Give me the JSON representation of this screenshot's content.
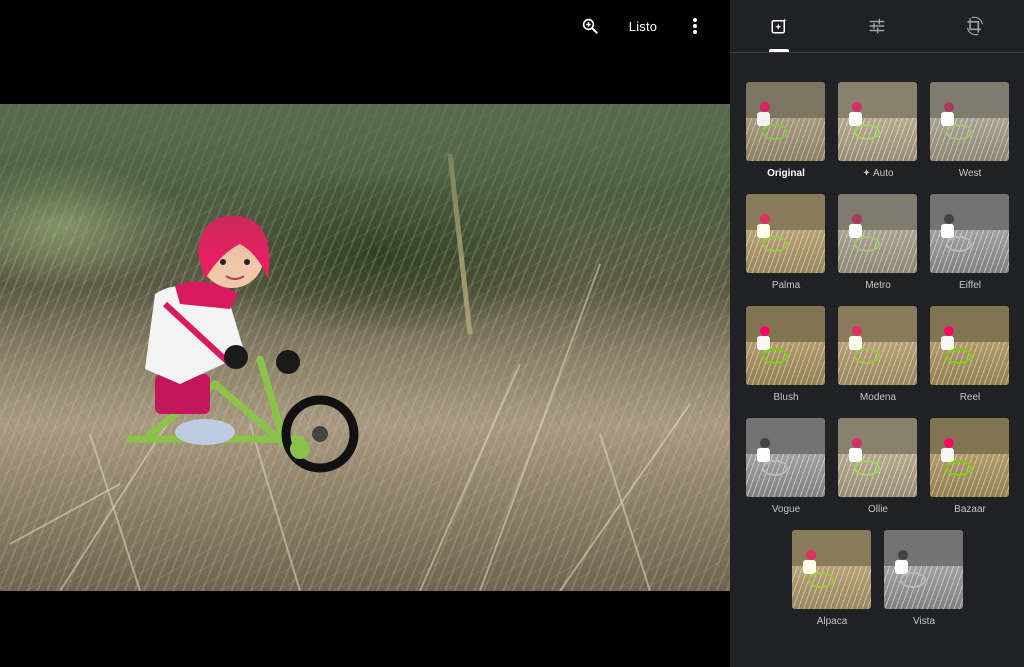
{
  "toolbar": {
    "zoom_icon": "zoom-in-icon",
    "done_label": "Listo",
    "more_icon": "more-vert-icon"
  },
  "panel": {
    "tabs": [
      {
        "icon": "photo-filter-icon",
        "selected": true
      },
      {
        "icon": "tune-sliders-icon",
        "selected": false
      },
      {
        "icon": "crop-rotate-icon",
        "selected": false
      }
    ],
    "filters": [
      {
        "label": "Original",
        "selected": true
      },
      {
        "label": "Auto",
        "icon": "sparkle-icon"
      },
      {
        "label": "West"
      },
      {
        "label": "Palma"
      },
      {
        "label": "Metro"
      },
      {
        "label": "Eiffel"
      },
      {
        "label": "Blush"
      },
      {
        "label": "Modena"
      },
      {
        "label": "Reel"
      },
      {
        "label": "Vogue"
      },
      {
        "label": "Ollie"
      },
      {
        "label": "Bazaar"
      },
      {
        "label": "Alpaca"
      },
      {
        "label": "Vista"
      }
    ]
  },
  "colors": {
    "panel_bg": "#202124",
    "stage_bg": "#000000",
    "text_primary": "#ffffff",
    "text_secondary": "#c4c7c5"
  }
}
